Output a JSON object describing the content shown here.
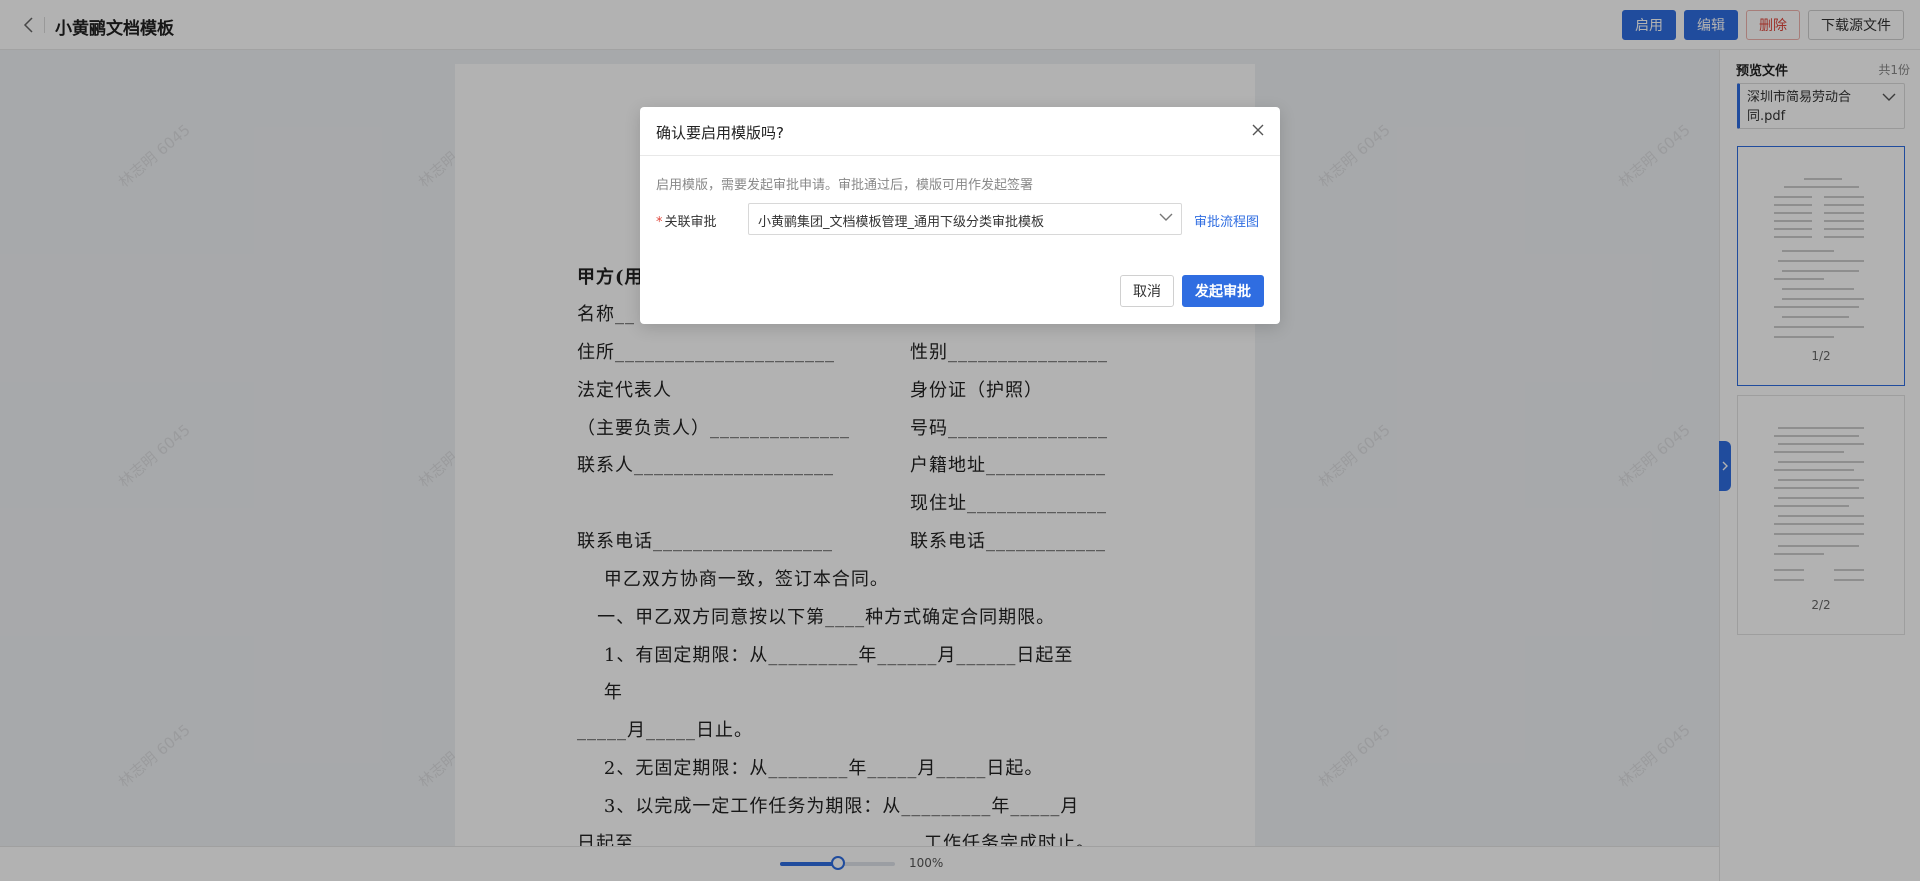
{
  "header": {
    "title": "小黄鹂文档模板",
    "actions": {
      "enable": "启用",
      "edit": "编辑",
      "delete": "删除",
      "download": "下载源文件"
    }
  },
  "document": {
    "lines_left": [
      "甲方(用",
      "名称__",
      "住所______________________",
      "法定代表人",
      "（主要负责人）______________",
      "联系人____________________",
      "",
      "联系电话__________________"
    ],
    "lines_right": [
      "",
      "",
      "性别________________",
      "身份证（护照）",
      "号码________________",
      "户籍地址____________",
      "现住址______________",
      "联系电话____________"
    ],
    "body": [
      "    甲乙双方协商一致，签订本合同。",
      "   一、甲乙双方同意按以下第____种方式确定合同期限。",
      "    1、有固定期限：从_________年______月______日起至",
      "    年",
      "_____月_____日止。",
      "    2、无固定期限：从________年_____月_____日起。",
      "    3、以完成一定工作任务为期限：从_________年_____月",
      "日起至_____________________________工作任务完成时止。"
    ],
    "watermark": "林志明 6045"
  },
  "zoom": {
    "percent": 100,
    "label": "100%"
  },
  "sidebar": {
    "heading": "预览文件",
    "count": "共1份",
    "file_name": "深圳市简易劳动合同.pdf",
    "pages": [
      "1/2",
      "2/2"
    ]
  },
  "modal": {
    "title": "确认要启用模版吗?",
    "description": "启用模版，需要发起审批申请。审批通过后，模版可用作发起签署",
    "field_label": "关联审批",
    "field_value": "小黄鹂集团_文档模板管理_通用下级分类审批模板",
    "flow_link": "审批流程图",
    "cancel": "取消",
    "submit": "发起审批"
  },
  "colors": {
    "primary": "#2f6de1",
    "danger": "#e0453a"
  }
}
